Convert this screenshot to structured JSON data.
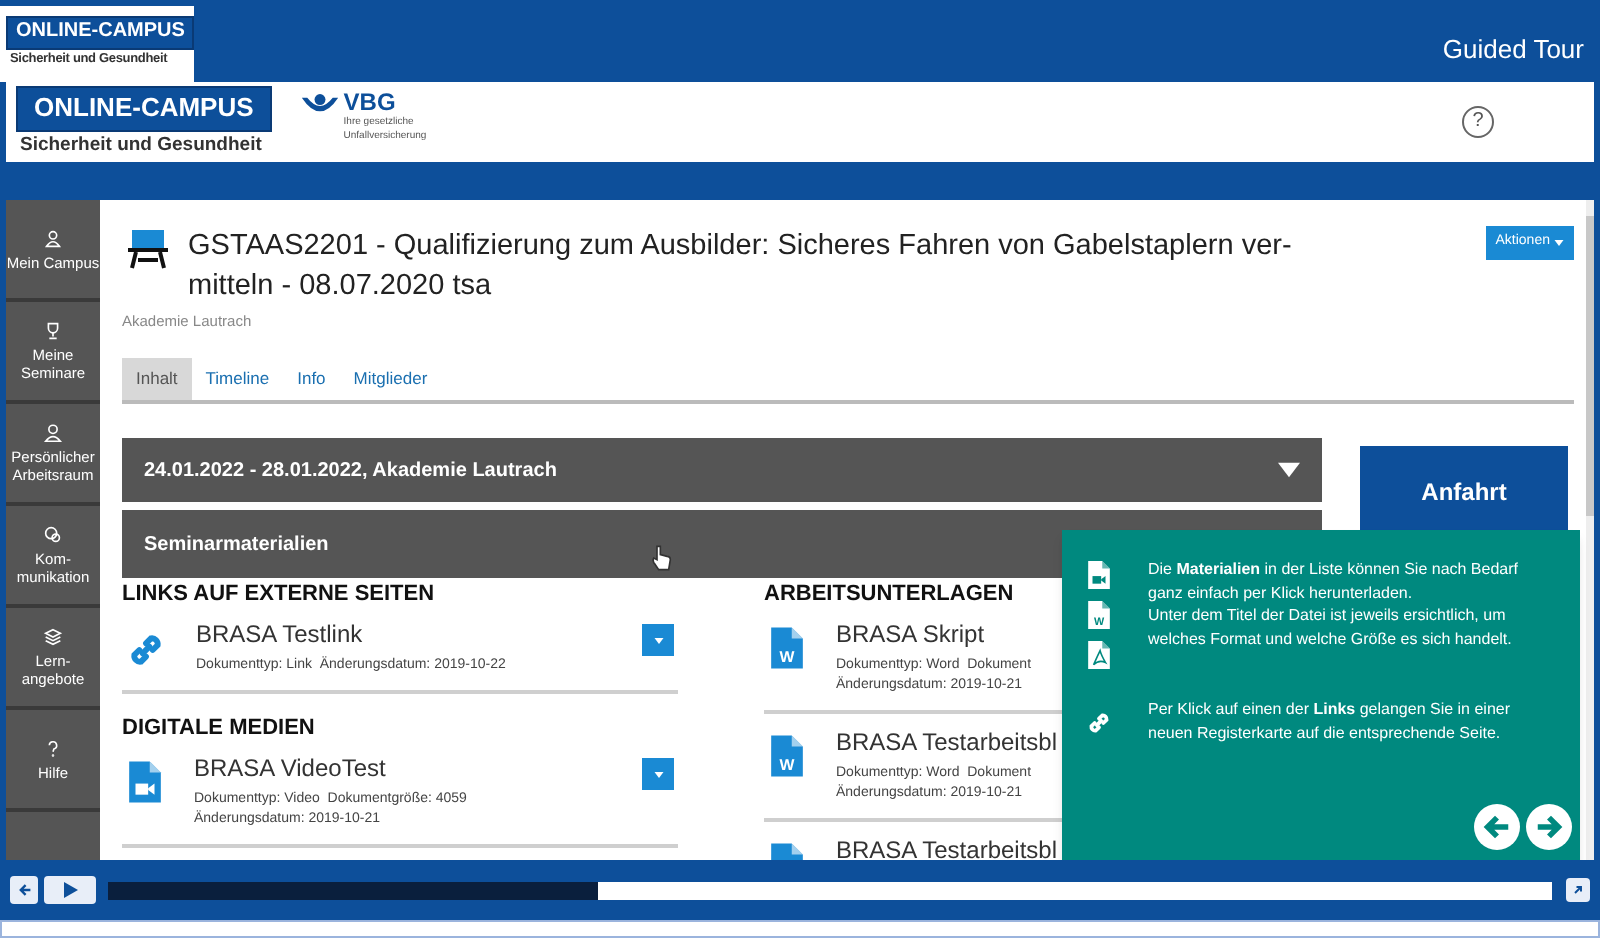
{
  "tour_header": {
    "logo_title": "ONLINE-CAMPUS",
    "logo_subtitle": "Sicherheit und Gesundheit",
    "title": "Guided Tour"
  },
  "app_header": {
    "logo_title": "ONLINE-CAMPUS",
    "logo_subtitle": "Sicherheit und Gesundheit",
    "partner_name": "VBG",
    "partner_tagline": "Ihre gesetzliche Unfallversicherung",
    "help": "?"
  },
  "sidebar": {
    "items": [
      {
        "label": "Mein Campus"
      },
      {
        "label": "Meine Seminare"
      },
      {
        "label": "Persönlicher Arbeitsraum"
      },
      {
        "label": "Kom-munikation"
      },
      {
        "label": "Lern-angebote"
      },
      {
        "label": "Hilfe"
      }
    ]
  },
  "page": {
    "title_lines": [
      "GSTAAS2201 - Qualifizierung zum Ausbilder: Sicheres Fahren von Gabelstaplern ver-",
      "mitteln - 08.07.2020 tsa"
    ],
    "actions_button": "Aktionen",
    "subtitle": "Akademie Lautrach",
    "tabs": [
      {
        "label": "Inhalt",
        "selected": true
      },
      {
        "label": "Timeline",
        "selected": false
      },
      {
        "label": "Info",
        "selected": false
      },
      {
        "label": "Mitglieder",
        "selected": false
      }
    ],
    "date_bar": "24.01.2022 - 28.01.2022, Akademie Lautrach",
    "section_bar": "Seminarmaterialien",
    "side_button": "Anfahrt",
    "columns": [
      [
        {
          "heading": "LINKS AUF EXTERNE SEITEN",
          "items": [
            {
              "kind": "link",
              "title": "BRASA Testlink",
              "meta": [
                "Dokumenttyp: Link  Änderungsdatum: 2019-10-22"
              ]
            }
          ]
        },
        {
          "heading": "DIGITALE MEDIEN",
          "items": [
            {
              "kind": "video",
              "title": "BRASA VideoTest",
              "meta": [
                "Dokumenttyp: Video  Dokumentgröße: 4059",
                "Änderungsdatum: 2019-10-21"
              ]
            }
          ]
        }
      ],
      [
        {
          "heading": "ARBEITSUNTERLAGEN",
          "items": [
            {
              "kind": "word",
              "icon_label": "W",
              "title": "BRASA Skript",
              "meta": [
                "Dokumenttyp: Word  Dokument",
                "Änderungsdatum: 2019-10-21"
              ]
            },
            {
              "kind": "word",
              "icon_label": "W",
              "title": "BRASA Testarbeitsbl",
              "meta": [
                "Dokumenttyp: Word  Dokument",
                "Änderungsdatum: 2019-10-21"
              ]
            },
            {
              "kind": "word",
              "title": "BRASA Testarbeitsbl"
            }
          ]
        }
      ]
    ]
  },
  "tour_popup": {
    "word_icon_label": "W",
    "paragraphs": [
      "Die **Materialien** in der Liste können Sie nach Bedarf ganz einfach per Klick herunterladen.",
      "Unter dem Titel der Datei ist jeweils ersichtlich, um welches Format und welche Größe es sich handelt.",
      "Per Klick auf einen der **Links** gelangen Sie in einer neuen Registerkarte auf die entsprechende Seite."
    ]
  },
  "player": {
    "level": 0.34
  }
}
